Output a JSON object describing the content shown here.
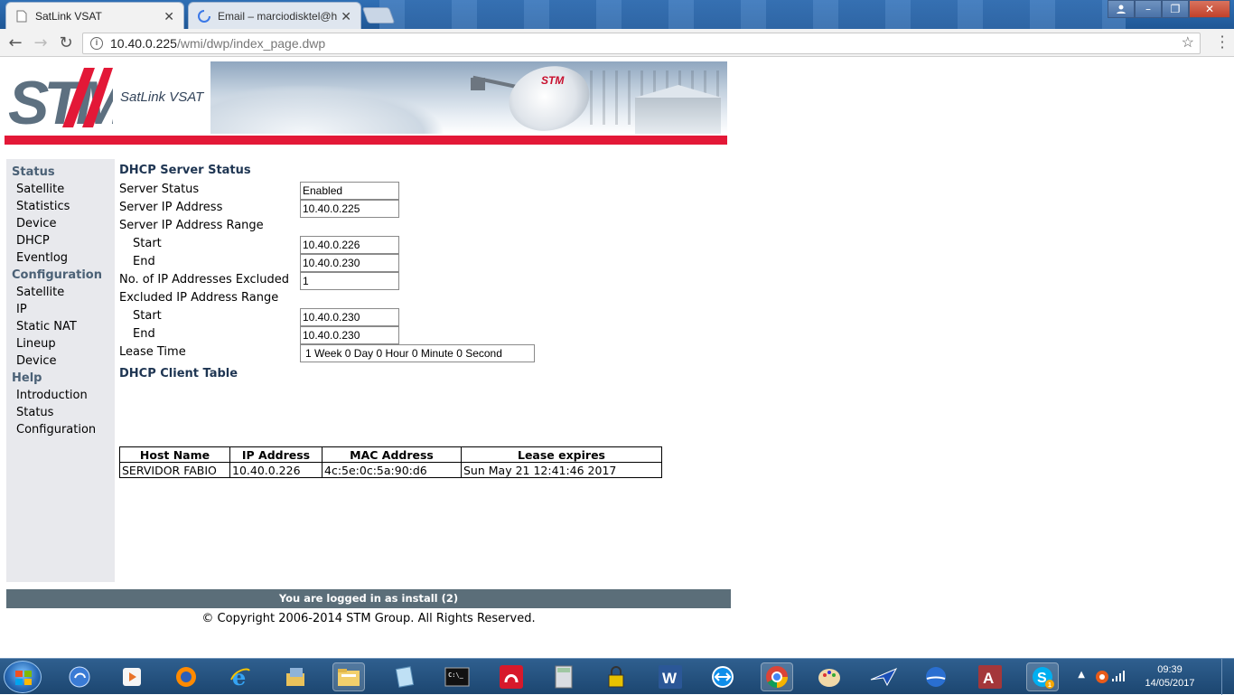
{
  "browser": {
    "tabs": [
      {
        "title": "SatLink VSAT",
        "active": true
      },
      {
        "title": "Email – marciodisktel@h",
        "active": false
      }
    ],
    "url_host": "10.40.0.225",
    "url_path": "/wmi/dwp/index_page.dwp"
  },
  "header": {
    "logo_text": "STM",
    "brand": "SatLink VSAT",
    "dish_logo": "STM"
  },
  "sidebar": {
    "status_heading": "Status",
    "status_items": [
      "Satellite",
      "Statistics",
      "Device",
      "DHCP",
      "Eventlog"
    ],
    "config_heading": "Configuration",
    "config_items": [
      "Satellite",
      "IP",
      "Static NAT",
      "Lineup",
      "Device"
    ],
    "help_heading": "Help",
    "help_items": [
      "Introduction",
      "Status",
      "Configuration"
    ]
  },
  "dhcp": {
    "title": "DHCP Server Status",
    "server_status_label": "Server Status",
    "server_status": "Enabled",
    "server_ip_label": "Server IP Address",
    "server_ip": "10.40.0.225",
    "range_label": "Server IP Address Range",
    "start_label": "Start",
    "range_start": "10.40.0.226",
    "end_label": "End",
    "range_end": "10.40.0.230",
    "excluded_count_label": "No. of IP Addresses Excluded",
    "excluded_count": "1",
    "excluded_range_label": "Excluded IP Address Range",
    "excluded_start_label": "Start",
    "excluded_start": "10.40.0.230",
    "excluded_end_label": "End",
    "excluded_end": "10.40.0.230",
    "lease_label": "Lease Time",
    "lease_time": "1 Week 0 Day 0 Hour 0 Minute 0 Second"
  },
  "client_table": {
    "title": "DHCP Client Table",
    "headers": [
      "Host Name",
      "IP Address",
      "MAC Address",
      "Lease expires"
    ],
    "rows": [
      [
        "SERVIDOR FABIO",
        "10.40.0.226",
        "4c:5e:0c:5a:90:d6",
        "Sun May 21 12:41:46 2017"
      ]
    ]
  },
  "footer": {
    "login_status": "You are logged in as install (2)",
    "copyright": "© Copyright 2006-2014 STM Group. All Rights Reserved."
  },
  "taskbar": {
    "time": "09:39",
    "date": "14/05/2017",
    "icons": [
      "ie-classic-icon",
      "media-player-icon",
      "firefox-icon",
      "internet-explorer-icon",
      "folder-tools-icon",
      "file-explorer-icon",
      "notepad-icon",
      "command-prompt-icon",
      "remote-app-icon",
      "calculator-icon",
      "lock-app-icon",
      "word-icon",
      "teamviewer-icon",
      "chrome-icon",
      "paint-icon",
      "network-app-icon",
      "google-earth-icon",
      "access-icon",
      "skype-icon"
    ]
  },
  "colors": {
    "brand_red": "#e31837",
    "sidebar_bg": "#e8e9ed",
    "section_heading": "#4b6176",
    "status_bar": "#5b6e79"
  }
}
